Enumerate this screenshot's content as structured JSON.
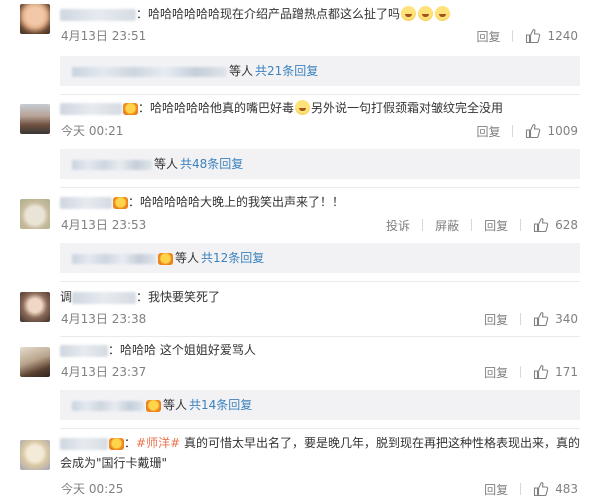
{
  "comments": [
    {
      "text": "哈哈哈哈哈哈现在介绍产品蹭热点都这么扯了吗",
      "emoji_count": 3,
      "time": "4月13日 23:51",
      "actions": [
        "回复"
      ],
      "likes": "1240",
      "replies": {
        "label": "等人",
        "count": "共21条回复"
      }
    },
    {
      "text_a": "哈哈哈哈哈他真的嘴巴好毒",
      "text_b": "另外说一句打假颈霜对皱纹完全没用",
      "time": "今天 00:21",
      "actions": [
        "回复"
      ],
      "likes": "1009",
      "replies": {
        "label": "等人",
        "count": "共48条回复"
      }
    },
    {
      "text": "哈哈哈哈哈大晚上的我笑出声来了！！",
      "time": "4月13日 23:53",
      "actions": [
        "投诉",
        "屏蔽",
        "回复"
      ],
      "likes": "628",
      "replies": {
        "label": "等人",
        "count": "共12条回复"
      }
    },
    {
      "name_prefix": "调",
      "text": "我快要笑死了",
      "time": "4月13日 23:38",
      "actions": [
        "回复"
      ],
      "likes": "340"
    },
    {
      "text": "哈哈哈  这个姐姐好爱骂人",
      "time": "4月13日 23:37",
      "actions": [
        "回复"
      ],
      "likes": "171",
      "replies": {
        "label": "等人",
        "count": "共14条回复"
      }
    },
    {
      "hashtag": "#师洋#",
      "text_a": "真的可惜太早出名了，要是晚几年，脱到现在再把这种性格表现出来，真的",
      "text_b": "会成为\"国行卡戴珊\"",
      "time": "今天 00:25",
      "actions": [
        "回复"
      ],
      "likes": "483"
    }
  ],
  "icons": {
    "like": "thumbs-up-icon",
    "vip": "vip-badge-icon",
    "emoji": "laughing-emoji-icon"
  },
  "colors": {
    "link": "#3c82bd",
    "hashtag": "#eb7350",
    "muted": "#808080",
    "reply_bg": "#f2f2f5"
  }
}
